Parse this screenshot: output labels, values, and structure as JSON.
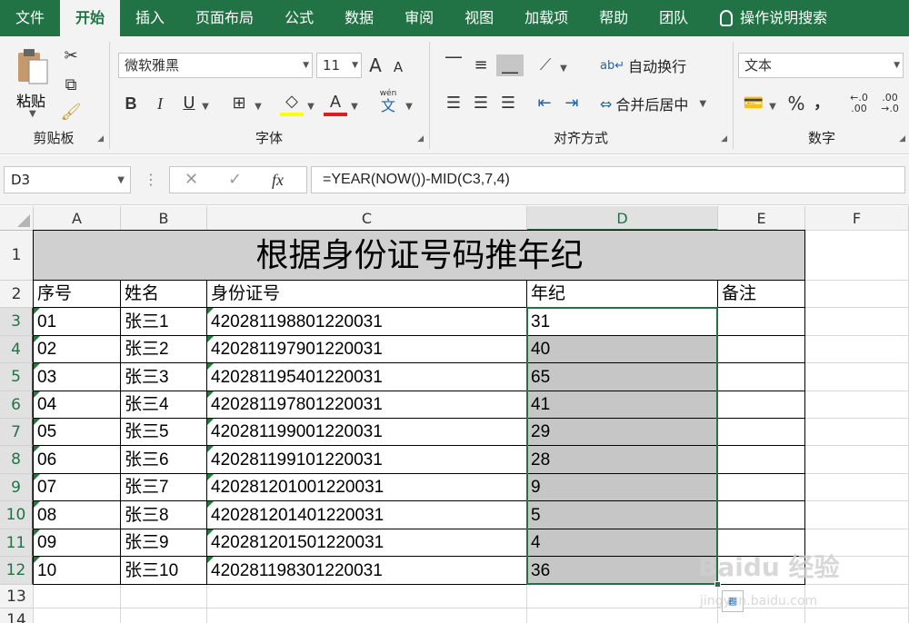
{
  "tabs": [
    "文件",
    "开始",
    "插入",
    "页面布局",
    "公式",
    "数据",
    "审阅",
    "视图",
    "加载项",
    "帮助",
    "团队",
    "操作说明搜索"
  ],
  "ribbon": {
    "clipboard": {
      "paste": "粘贴",
      "label": "剪贴板"
    },
    "font": {
      "family": "微软雅黑",
      "size": "11",
      "grow": "A",
      "shrink": "A",
      "bold": "B",
      "italic": "I",
      "underline": "U",
      "font_color_letter": "A",
      "label": "字体",
      "wen": "wén",
      "wen_char": "文"
    },
    "alignment": {
      "wrap": "自动换行",
      "merge": "合并后居中",
      "label": "对齐方式"
    },
    "number": {
      "format": "文本",
      "percent": "%",
      "comma": "，",
      "inc_decimal": "←.0 .00",
      "dec_decimal": ".00 →.0",
      "label": "数字"
    }
  },
  "formula_bar": {
    "namebox": "D3",
    "fx": "fx",
    "formula": "=YEAR(NOW())-MID(C3,7,4)"
  },
  "columns": [
    "A",
    "B",
    "C",
    "D",
    "E",
    "F"
  ],
  "rows": [
    "1",
    "2",
    "3",
    "4",
    "5",
    "6",
    "7",
    "8",
    "9",
    "10",
    "11",
    "12",
    "13",
    "14"
  ],
  "sheet": {
    "title": "根据身份证号码推年纪",
    "headers": [
      "序号",
      "姓名",
      "身份证号",
      "年纪",
      "备注"
    ],
    "data": [
      [
        "01",
        "张三1",
        "420281198801220031",
        "31"
      ],
      [
        "02",
        "张三2",
        "420281197901220031",
        "40"
      ],
      [
        "03",
        "张三3",
        "420281195401220031",
        "65"
      ],
      [
        "04",
        "张三4",
        "420281197801220031",
        "41"
      ],
      [
        "05",
        "张三5",
        "420281199001220031",
        "29"
      ],
      [
        "06",
        "张三6",
        "420281199101220031",
        "28"
      ],
      [
        "07",
        "张三7",
        "420281201001220031",
        "9"
      ],
      [
        "08",
        "张三8",
        "420281201401220031",
        "5"
      ],
      [
        "09",
        "张三9",
        "420281201501220031",
        "4"
      ],
      [
        "10",
        "张三10",
        "420281198301220031",
        "36"
      ]
    ]
  },
  "watermark": "Baidu 经验",
  "watermark_url": "jingyan.baidu.com",
  "colors": {
    "accent": "#217346",
    "selection_fill": "#c6c6c6",
    "title_fill": "#d0d0d0",
    "error_triangle": "#1e7b38"
  }
}
